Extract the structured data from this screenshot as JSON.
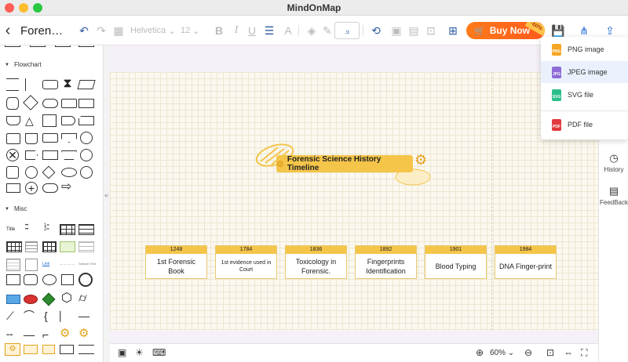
{
  "window": {
    "title": "MindOnMap"
  },
  "toolbar": {
    "back_glyph": "‹",
    "doc_title": "Foren…",
    "font_family": "Helvetica",
    "font_size": "12",
    "buy_label": "Buy Now",
    "discount": "-60%",
    "icons": [
      "undo-icon",
      "redo-icon",
      "format-painter-icon",
      "bold-icon",
      "italic-icon",
      "underline-icon",
      "align-icon",
      "text-style-icon",
      "fill-icon",
      "border-color-icon",
      "connector-style-icon",
      "rotate-icon",
      "group-icon",
      "ungroup-icon",
      "lock-icon",
      "table-icon",
      "save-icon",
      "share-icon",
      "export-icon"
    ]
  },
  "left_panel": {
    "flowchart_label": "Flowchart",
    "misc_label": "Misc",
    "misc_title_label": "Title",
    "misc_link_label": "Link",
    "misc_sample_label": "Sample Text"
  },
  "canvas": {
    "title": "Forensic Science History Timeline",
    "events": [
      {
        "year": "1248",
        "label": "1st Forensic Book"
      },
      {
        "year": "1784",
        "label": "1st evidence used in Court"
      },
      {
        "year": "1836",
        "label": "Toxicology in Forensic."
      },
      {
        "year": "1892",
        "label": "Fingerprints Identification"
      },
      {
        "year": "1901",
        "label": "Blood Typing"
      },
      {
        "year": "1984",
        "label": "DNA Finger-print"
      }
    ]
  },
  "export_menu": {
    "items": [
      {
        "label": "PNG image",
        "icon_text": "PNG",
        "color": "#f5a623"
      },
      {
        "label": "JPEG image",
        "icon_text": "JPG",
        "color": "#8e6bd8"
      },
      {
        "label": "SVG file",
        "icon_text": "SVG",
        "color": "#2bbf8a"
      },
      {
        "label": "PDF file",
        "icon_text": "PDF",
        "color": "#e0393e"
      }
    ]
  },
  "right_panel": {
    "history_label": "History",
    "feedback_label": "FeedBack"
  },
  "bottom_bar": {
    "zoom": "60%"
  },
  "colors": {
    "accent": "#f5c54a",
    "buy_orange": "#ff6a1a",
    "primary_blue": "#1e6bd6"
  }
}
